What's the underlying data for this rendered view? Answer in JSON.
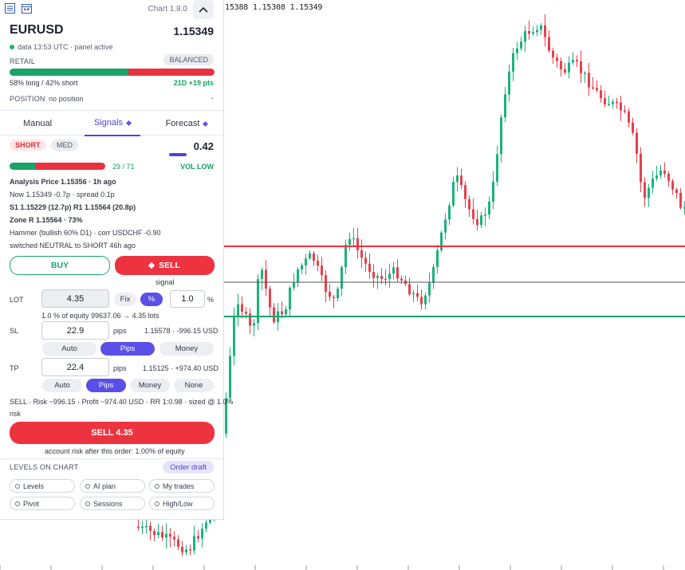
{
  "chart": {
    "ohlc_readout": "15388 1.15308 1.15349",
    "lines": {
      "red_level_color": "#e8323f",
      "green_level_color": "#1aa36a",
      "current_price_color": "#555555"
    },
    "candle_colors": {
      "up": "#1bb37a",
      "down": "#e8404c"
    }
  },
  "panel": {
    "topbar": {
      "icon_left": "list-icon",
      "icon_right": "calendar-icon",
      "version": "Chart 1.8.0",
      "collapse_icon": "^"
    },
    "symbol": "EURUSD",
    "price": "1.15349",
    "data_status": "data 13:53 UTC · panel active",
    "retail": {
      "label": "RETAIL",
      "badge": "BALANCED",
      "long_pct": 58,
      "short_pct": 42,
      "summary": "58% long / 42% short",
      "change": "21D +19 pts"
    },
    "position": {
      "label": "POSITION",
      "value": "no position",
      "dash": "-"
    },
    "tabs": [
      {
        "label": "Manual"
      },
      {
        "label": "Signals"
      },
      {
        "label": "Forecast"
      }
    ],
    "signal": {
      "direction": "SHORT",
      "strength": "MED",
      "score": "0.42",
      "score_bar": {
        "green_frac": 0.27,
        "ratio_text": "29 / 71"
      },
      "vol": "VOL LOW"
    },
    "analysis": {
      "price_line": "Analysis Price 1.15356 · 1h ago",
      "now_line": "Now 1.15349 -0.7p · spread 0.1p",
      "sr_line": "S1 1.15229 (12.7p)  R1 1.15564 (20.8p)",
      "zone_line": "Zone R 1.15564 · 73%",
      "pattern_line": "Hammer (bullish 60% D1) · corr USDCHF -0.90",
      "switch_line": "switched NEUTRAL to SHORT 46h ago"
    },
    "trade": {
      "buy_label": "BUY",
      "sell_label": "SELL",
      "signal_caption": "signal",
      "lot": {
        "label": "LOT",
        "value": "4.35",
        "fix": "Fix",
        "pct": "%",
        "pct_value": "1.0",
        "pct_unit": "%"
      },
      "equity_line": "1.0 % of equity 99637.06 → 4.35 lots",
      "sl": {
        "label": "SL",
        "value": "22.9",
        "unit": "pips",
        "info": "1.15578 · -996.15 USD"
      },
      "sl_modes": [
        "Auto",
        "Pips",
        "Money"
      ],
      "tp": {
        "label": "TP",
        "value": "22.4",
        "unit": "pips",
        "info": "1.15125 · +974.40 USD"
      },
      "tp_modes": [
        "Auto",
        "Pips",
        "Money",
        "None"
      ],
      "summary_line1": "SELL · Risk ~996.15 · Profit ~974.40 USD · RR 1:0.98 · sized @ 1.0%",
      "summary_line2": "risk",
      "submit_label": "SELL 4.35",
      "risk_note": "account risk after this order: 1.00% of equity"
    },
    "levels": {
      "label": "LEVELS ON CHART",
      "order_draft": "Order draft",
      "chips": [
        "Levels",
        "AI plan",
        "My trades",
        "Pivot",
        "Sessions",
        "High/Low"
      ]
    }
  }
}
